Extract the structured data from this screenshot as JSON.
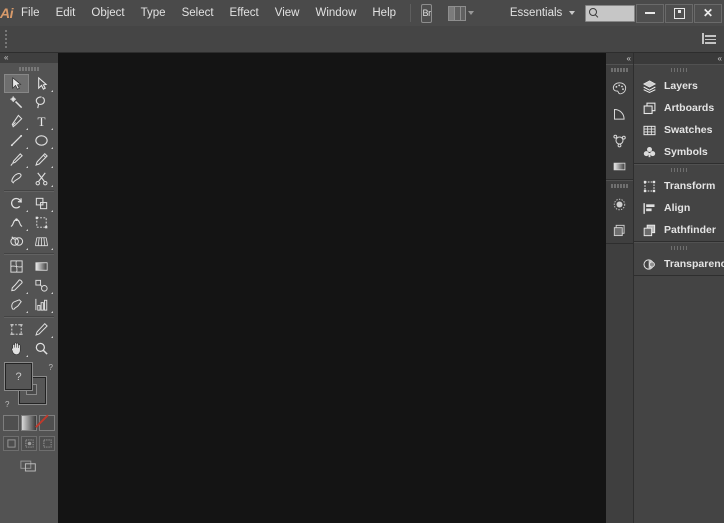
{
  "app": {
    "name": "Adobe Illustrator",
    "logo_text": "Ai",
    "logo_color": "#d89a6a"
  },
  "menubar": {
    "items": [
      {
        "label": "File"
      },
      {
        "label": "Edit"
      },
      {
        "label": "Object"
      },
      {
        "label": "Type"
      },
      {
        "label": "Select"
      },
      {
        "label": "Effect"
      },
      {
        "label": "View"
      },
      {
        "label": "Window"
      },
      {
        "label": "Help"
      }
    ],
    "bridge_button": "Br",
    "arrange_documents_icon": "arrange-documents-icon",
    "workspace": {
      "label": "Essentials",
      "caret_icon": "chevron-down-icon"
    },
    "search": {
      "value": "",
      "placeholder": "",
      "icon": "search-icon"
    },
    "window_controls": {
      "minimize": "minimize-icon",
      "maximize": "maximize-icon",
      "close": "close-icon"
    }
  },
  "controlbar": {
    "grip": "drag-grip",
    "panel_menu_icon": "panel-menu-icon"
  },
  "toolbar": {
    "collapse_icon": "collapse-chevrons-icon",
    "grip": "drag-grip",
    "groups": [
      {
        "tools": [
          {
            "name": "selection-tool",
            "icon": "arrow-solid",
            "active": true,
            "has_flyout": false
          },
          {
            "name": "direct-selection-tool",
            "icon": "arrow-outline",
            "active": false,
            "has_flyout": true
          },
          {
            "name": "magic-wand-tool",
            "icon": "magic-wand",
            "active": false,
            "has_flyout": false
          },
          {
            "name": "lasso-tool",
            "icon": "lasso",
            "active": false,
            "has_flyout": false
          },
          {
            "name": "pen-tool",
            "icon": "pen",
            "active": false,
            "has_flyout": true
          },
          {
            "name": "type-tool",
            "icon": "type-t",
            "active": false,
            "has_flyout": true
          },
          {
            "name": "line-segment-tool",
            "icon": "line",
            "active": false,
            "has_flyout": true
          },
          {
            "name": "ellipse-tool",
            "icon": "ellipse",
            "active": false,
            "has_flyout": true
          },
          {
            "name": "paintbrush-tool",
            "icon": "paintbrush",
            "active": false,
            "has_flyout": true
          },
          {
            "name": "pencil-tool",
            "icon": "pencil",
            "active": false,
            "has_flyout": true
          },
          {
            "name": "blob-brush-tool",
            "icon": "blob-brush",
            "active": false,
            "has_flyout": false
          },
          {
            "name": "eraser-tool",
            "icon": "scissors",
            "active": false,
            "has_flyout": true
          }
        ]
      },
      {
        "tools": [
          {
            "name": "rotate-tool",
            "icon": "rotate",
            "active": false,
            "has_flyout": true
          },
          {
            "name": "scale-tool",
            "icon": "scale",
            "active": false,
            "has_flyout": true
          },
          {
            "name": "width-tool",
            "icon": "width",
            "active": false,
            "has_flyout": true
          },
          {
            "name": "free-transform-tool",
            "icon": "free-transform",
            "active": false,
            "has_flyout": false
          },
          {
            "name": "shape-builder-tool",
            "icon": "shape-builder",
            "active": false,
            "has_flyout": true
          },
          {
            "name": "perspective-grid-tool",
            "icon": "perspective-grid",
            "active": false,
            "has_flyout": true
          }
        ]
      },
      {
        "tools": [
          {
            "name": "mesh-tool",
            "icon": "mesh",
            "active": false,
            "has_flyout": false
          },
          {
            "name": "gradient-tool",
            "icon": "gradient",
            "active": false,
            "has_flyout": false
          },
          {
            "name": "eyedropper-tool",
            "icon": "eyedropper",
            "active": false,
            "has_flyout": true
          },
          {
            "name": "blend-tool",
            "icon": "blend",
            "active": false,
            "has_flyout": true
          },
          {
            "name": "symbol-sprayer-tool",
            "icon": "symbol-sprayer",
            "active": false,
            "has_flyout": true
          },
          {
            "name": "column-graph-tool",
            "icon": "column-graph",
            "active": false,
            "has_flyout": true
          }
        ]
      },
      {
        "tools": [
          {
            "name": "artboard-tool",
            "icon": "artboard",
            "active": false,
            "has_flyout": false
          },
          {
            "name": "slice-tool",
            "icon": "slice",
            "active": false,
            "has_flyout": true
          },
          {
            "name": "hand-tool",
            "icon": "hand",
            "active": false,
            "has_flyout": true
          },
          {
            "name": "zoom-tool",
            "icon": "zoom-magnifier",
            "active": false,
            "has_flyout": false
          }
        ]
      }
    ],
    "fill_stroke": {
      "fill_name": "fill-color-swatch",
      "fill_glyph": "?",
      "stroke_name": "stroke-color-swatch",
      "stroke_glyph": "?",
      "swap_name": "swap-fill-stroke-icon",
      "swap_glyph": "?",
      "default_name": "default-fill-stroke-icon",
      "default_glyph": "?"
    },
    "color_modes": [
      {
        "name": "color-mode-solid",
        "type": "solid"
      },
      {
        "name": "color-mode-gradient",
        "type": "gradient"
      },
      {
        "name": "color-mode-none",
        "type": "none"
      }
    ],
    "draw_modes": [
      {
        "name": "draw-normal-mode"
      },
      {
        "name": "draw-behind-mode"
      },
      {
        "name": "draw-inside-mode"
      }
    ],
    "screen_mode": {
      "name": "change-screen-mode-button"
    }
  },
  "canvas": {
    "name": "document-canvas",
    "background": "#141414"
  },
  "dock": {
    "collapse_icon_left": "collapse-chevrons-icon",
    "collapse_icon_right": "collapse-chevrons-icon",
    "icon_groups": [
      {
        "items": [
          {
            "name": "color-panel-icon",
            "icon": "palette"
          },
          {
            "name": "color-guide-panel-icon",
            "icon": "color-guide"
          },
          {
            "name": "graphic-styles-panel-icon",
            "icon": "graphic-styles"
          },
          {
            "name": "gradient-panel-icon",
            "icon": "gradient-bar"
          }
        ]
      },
      {
        "items": [
          {
            "name": "brushes-panel-icon",
            "icon": "brushes-circle"
          },
          {
            "name": "symbols-panel-icon",
            "icon": "symbols-stack"
          }
        ]
      }
    ],
    "panel_groups": [
      {
        "items": [
          {
            "label": "Layers",
            "name": "panel-item-layers",
            "icon": "layers"
          },
          {
            "label": "Artboards",
            "name": "panel-item-artboards",
            "icon": "artboards"
          },
          {
            "label": "Swatches",
            "name": "panel-item-swatches",
            "icon": "swatches-grid"
          },
          {
            "label": "Symbols",
            "name": "panel-item-symbols",
            "icon": "symbols-clover"
          }
        ]
      },
      {
        "items": [
          {
            "label": "Transform",
            "name": "panel-item-transform",
            "icon": "transform-box"
          },
          {
            "label": "Align",
            "name": "panel-item-align",
            "icon": "align-bars"
          },
          {
            "label": "Pathfinder",
            "name": "panel-item-pathfinder",
            "icon": "pathfinder-shapes"
          }
        ]
      },
      {
        "items": [
          {
            "label": "Transparency",
            "name": "panel-item-transparency",
            "icon": "transparency-circle"
          }
        ]
      }
    ]
  }
}
